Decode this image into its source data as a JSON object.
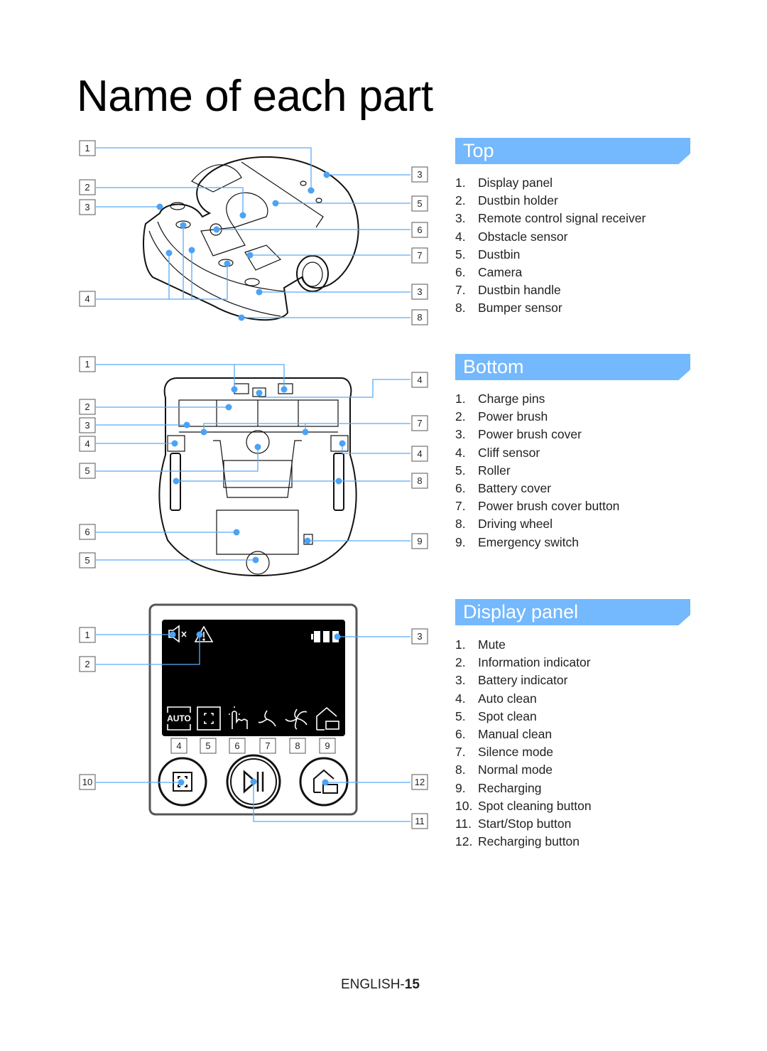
{
  "page": {
    "title": "Name of each part",
    "footer_prefix": "ENGLISH-",
    "footer_page": "15"
  },
  "colors": {
    "section_header_bg": "#74b8fd",
    "leader_line": "#5aabf5"
  },
  "sections": {
    "top": {
      "heading": "Top",
      "items": [
        {
          "num": "1.",
          "label": "Display panel"
        },
        {
          "num": "2.",
          "label": "Dustbin holder"
        },
        {
          "num": "3.",
          "label": "Remote control signal receiver"
        },
        {
          "num": "4.",
          "label": "Obstacle sensor"
        },
        {
          "num": "5.",
          "label": "Dustbin"
        },
        {
          "num": "6.",
          "label": "Camera"
        },
        {
          "num": "7.",
          "label": "Dustbin handle"
        },
        {
          "num": "8.",
          "label": "Bumper sensor"
        }
      ],
      "callouts": [
        "1",
        "2",
        "3",
        "4",
        "3",
        "5",
        "6",
        "7",
        "3",
        "8"
      ]
    },
    "bottom": {
      "heading": "Bottom",
      "items": [
        {
          "num": "1.",
          "label": "Charge pins"
        },
        {
          "num": "2.",
          "label": "Power brush"
        },
        {
          "num": "3.",
          "label": "Power brush cover"
        },
        {
          "num": "4.",
          "label": "Cliff sensor"
        },
        {
          "num": "5.",
          "label": "Roller"
        },
        {
          "num": "6.",
          "label": "Battery cover"
        },
        {
          "num": "7.",
          "label": "Power brush cover button"
        },
        {
          "num": "8.",
          "label": "Driving wheel"
        },
        {
          "num": "9.",
          "label": "Emergency switch"
        }
      ],
      "callouts": [
        "1",
        "2",
        "3",
        "4",
        "5",
        "6",
        "5",
        "4",
        "7",
        "4",
        "8",
        "9"
      ]
    },
    "display": {
      "heading": "Display panel",
      "items": [
        {
          "num": "1.",
          "label": "Mute"
        },
        {
          "num": "2.",
          "label": "Information indicator"
        },
        {
          "num": "3.",
          "label": "Battery indicator"
        },
        {
          "num": "4.",
          "label": "Auto clean"
        },
        {
          "num": "5.",
          "label": "Spot clean"
        },
        {
          "num": "6.",
          "label": "Manual clean"
        },
        {
          "num": "7.",
          "label": "Silence mode"
        },
        {
          "num": "8.",
          "label": "Normal mode"
        },
        {
          "num": "9.",
          "label": "Recharging"
        },
        {
          "num": "10.",
          "label": "Spot cleaning button"
        },
        {
          "num": "11.",
          "label": "Start/Stop button"
        },
        {
          "num": "12.",
          "label": "Recharging button"
        }
      ],
      "callouts": [
        "1",
        "2",
        "10",
        "3",
        "12",
        "11",
        "4",
        "5",
        "6",
        "7",
        "8",
        "9"
      ],
      "screen_auto_text": "AUTO",
      "icons": [
        "mute-icon",
        "warning-icon",
        "battery-icon",
        "auto-clean-icon",
        "spot-clean-icon",
        "manual-clean-icon",
        "silence-mode-icon",
        "normal-mode-icon",
        "recharging-icon",
        "spot-button-icon",
        "play-pause-icon",
        "home-dock-icon"
      ]
    }
  }
}
